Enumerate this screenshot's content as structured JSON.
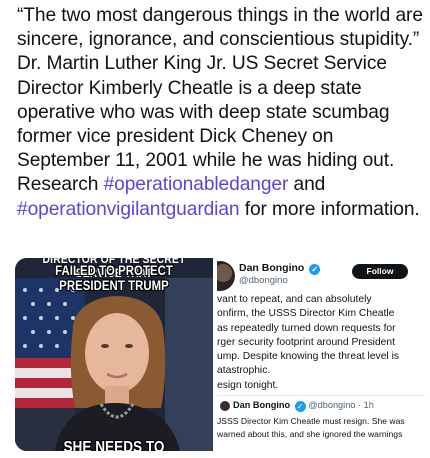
{
  "post": {
    "text_before": "“The two most dangerous things in the world are sincere, ignorance, and conscientious stupidity.” Dr. Martin Luther King Jr. US Secret Service Director Kimberly Cheatle is a deep state operative who was with deep state scumbag former vice president Dick Cheney on September 11, 2001 while he was hiding out. Research ",
    "hashtag1": "#operationabledanger",
    "text_middle": " and ",
    "hashtag2": "#operationvigilantguardian",
    "text_after": " for more information."
  },
  "meme": {
    "headline_cut": "DIRECTOR OF THE SECRET SERVICE THAT",
    "headline": "FAILED TO PROTECT PRESIDENT TRUMP",
    "bottom_caption": "SHE NEEDS TO"
  },
  "tweet": {
    "name": "Dan Bongino",
    "handle": "@dbongino",
    "follow_label": "Follow",
    "lines": [
      "vant to repeat, and can absolutely",
      "onfirm, the USSS Director Kim Cheatle",
      "as repeatedly turned down requests for",
      "rger security footprint around President",
      "ump. Despite knowing the threat level is",
      "atastrophic.",
      "esign tonight."
    ],
    "quote": {
      "name": "Dan Bongino",
      "handle": "@dbongino",
      "time": "· 1h",
      "lines": [
        "JSSS Director Kim Cheatle must resign. She was",
        "warned about this, and she ignored the warnings"
      ]
    }
  },
  "colors": {
    "hashtag": "#5b45d6",
    "verified": "#1d9bf0",
    "follow_button": "#0f1419"
  }
}
